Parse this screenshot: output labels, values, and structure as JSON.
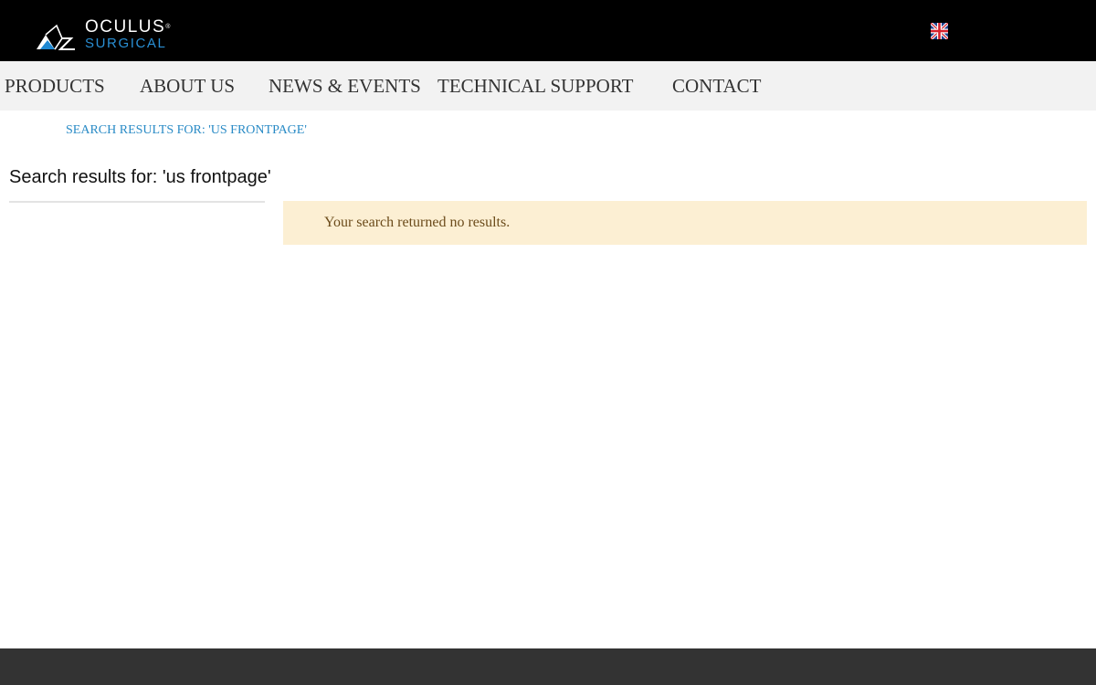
{
  "header": {
    "logo": {
      "name": "OCULUS",
      "registered_mark": "®",
      "subtitle": "SURGICAL"
    },
    "language_flag": "flag-uk-icon"
  },
  "nav": {
    "items": [
      {
        "label": "PRODUCTS"
      },
      {
        "label": "ABOUT US"
      },
      {
        "label": "NEWS & EVENTS"
      },
      {
        "label": "TECHNICAL SUPPORT"
      },
      {
        "label": "CONTACT"
      }
    ]
  },
  "breadcrumb": {
    "label": "SEARCH RESULTS FOR: 'US FRONTPAGE'"
  },
  "main": {
    "title": "Search results for: 'us frontpage'",
    "notice": "Your search returned no results."
  },
  "colors": {
    "topbar_bg": "#000000",
    "navbar_bg": "#f2f2f2",
    "accent_blue": "#2a8bc6",
    "notice_bg": "#fcefd3",
    "notice_text": "#6b4b1a",
    "footer_bg": "#333333"
  }
}
